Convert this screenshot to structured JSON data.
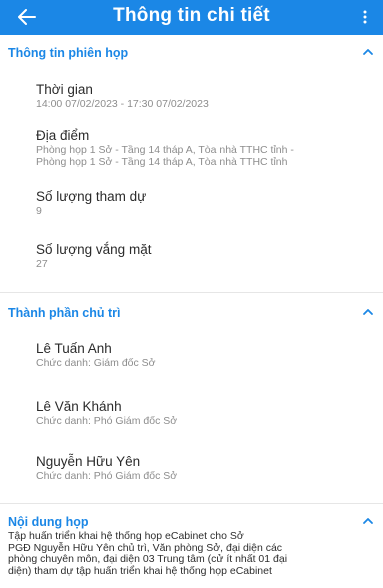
{
  "colors": {
    "accent": "#1b87e6",
    "background": "#ffffff",
    "value_text": "#8d8d8d"
  },
  "header": {
    "title": "Thông tin chi tiết",
    "back_icon": "arrow-left-icon",
    "menu_icon": "more-vertical-icon"
  },
  "sections": {
    "meeting_info": {
      "title": "Thông tin phiên họp",
      "toggle_icon": "chevron-up-icon",
      "time_label": "Thời gian",
      "time_value": "14:00 07/02/2023 - 17:30 07/02/2023",
      "location_label": "Địa điểm",
      "location_value_1": "Phòng họp 1 Sở - Tầng 14 tháp A, Tòa nhà TTHC tỉnh -",
      "location_value_2": "Phòng họp 1 Sở - Tầng 14 tháp A, Tòa nhà TTHC tỉnh",
      "attendees_label": "Số lượng tham dự",
      "attendees_value": "9",
      "absent_label": "Số lượng vắng mặt",
      "absent_value": "27"
    },
    "chairs": {
      "title": "Thành phần chủ trì",
      "toggle_icon": "chevron-up-icon",
      "people": [
        {
          "name": "Lê Tuấn Anh",
          "role": "Chức danh: Giám đốc Sở"
        },
        {
          "name": "Lê Văn Khánh",
          "role": "Chức danh: Phó Giám đốc Sở"
        },
        {
          "name": "Nguyễn Hữu Yên",
          "role": "Chức danh: Phó Giám đốc Sở"
        }
      ]
    },
    "content": {
      "title": "Nội dung họp",
      "toggle_icon": "chevron-up-icon",
      "lines": [
        "Tập huấn triển khai hệ thống họp eCabinet cho Sở",
        " PGĐ Nguyễn Hữu Yên chủ trì, Văn phòng Sở, đại diện các",
        "phòng chuyên môn, đại diện 03 Trung tâm (cử ít nhất 01 đại",
        "diện) tham dự tập huấn triển khai hệ thống họp eCabinet"
      ]
    }
  }
}
